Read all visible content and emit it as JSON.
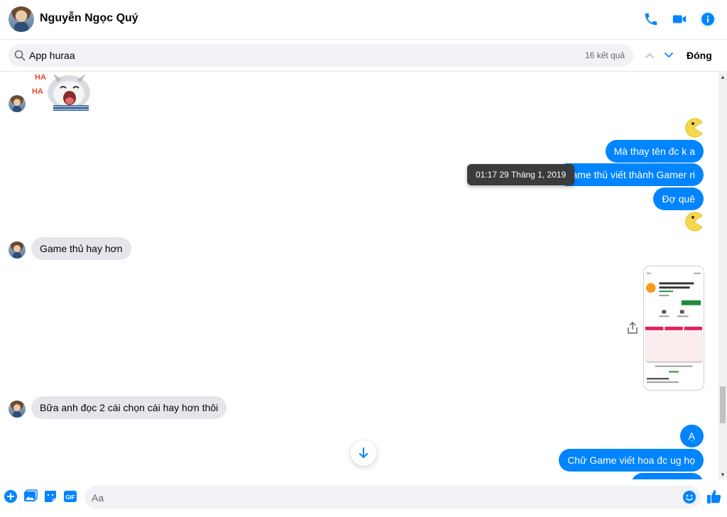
{
  "header": {
    "contact_name": "Nguyễn Ngọc Quý",
    "icons": [
      "phone-icon",
      "video-call-icon",
      "info-icon"
    ]
  },
  "search": {
    "value": "App huraa",
    "result_count": "16 kết quả",
    "close_label": "Đóng"
  },
  "messages": [
    {
      "side": "in",
      "type": "sticker",
      "icon": "laughing-cat-sticker"
    },
    {
      "side": "out",
      "type": "emoji",
      "icon": "pacman-emoji"
    },
    {
      "side": "out",
      "type": "text",
      "text": "Mà thay tên đc k a"
    },
    {
      "side": "out",
      "type": "text",
      "text": "Game thủ viết thành Gamer ri"
    },
    {
      "side": "out",
      "type": "text",
      "text": "Đợ quê"
    },
    {
      "side": "out",
      "type": "emoji",
      "icon": "pacman-emoji"
    },
    {
      "side": "in",
      "type": "text",
      "text": "Game thủ hay hơn"
    },
    {
      "side": "out",
      "type": "image",
      "icon": "app-screenshot"
    },
    {
      "side": "in",
      "type": "text",
      "text": "Bữa anh đọc 2 cái chọn cái hay hơn thôi"
    },
    {
      "side": "out",
      "type": "text",
      "text": "Ạ"
    },
    {
      "side": "out",
      "type": "text",
      "text": "Chữ Game viết hoa đc ug họ"
    }
  ],
  "tooltip": {
    "timestamp": "01:17 29 Tháng 1, 2019"
  },
  "composer": {
    "placeholder": "Aa",
    "icons": [
      "plus-icon",
      "image-icon",
      "sticker-icon",
      "gif-icon",
      "emoji-icon",
      "thumbs-up-icon"
    ],
    "gif_label": "GIF"
  },
  "colors": {
    "accent": "#0084ff",
    "incoming_bubble": "#e4e6eb",
    "search_bg": "#f0f2f5"
  }
}
